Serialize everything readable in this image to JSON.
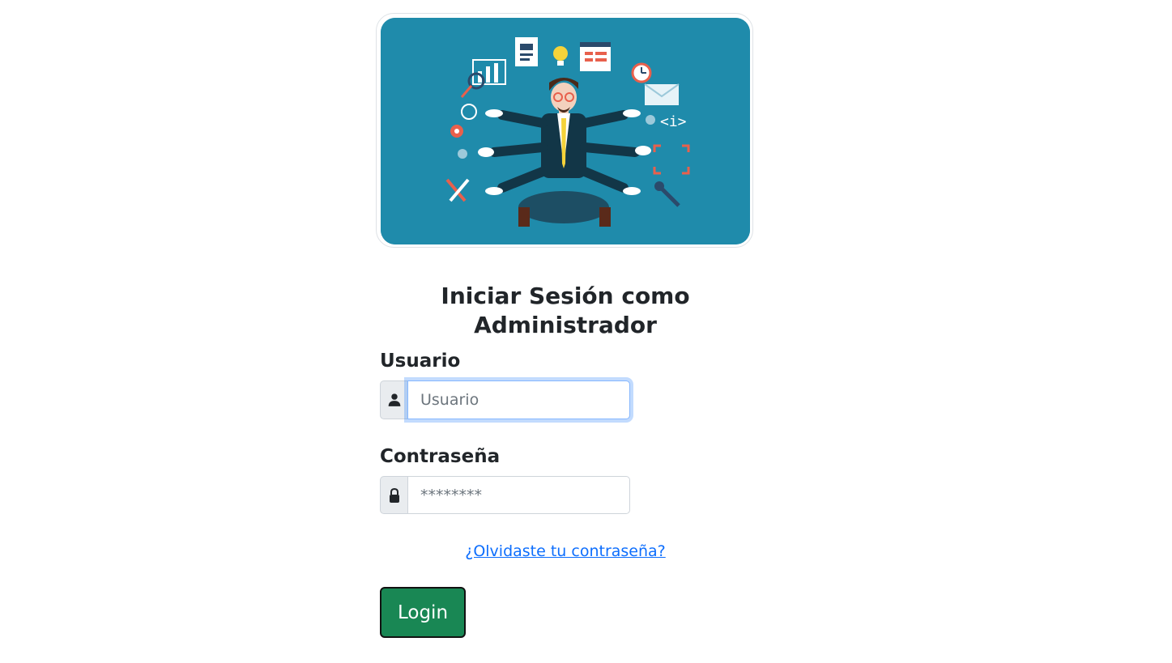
{
  "hero": {
    "image_alt": "Administrador multitarea",
    "background_color": "#1f8bab"
  },
  "login": {
    "title": "Iniciar Sesión como Administrador",
    "username_label": "Usuario",
    "username_placeholder": "Usuario",
    "username_value": "",
    "username_icon": "user-icon",
    "password_label": "Contraseña",
    "password_placeholder": "********",
    "password_value": "",
    "password_icon": "lock-icon",
    "forgot_link": "¿Olvidaste tu contraseña?",
    "login_button": "Login"
  },
  "colors": {
    "button": "#198754",
    "link": "#0d6efd",
    "focus": "#86b7fe"
  }
}
